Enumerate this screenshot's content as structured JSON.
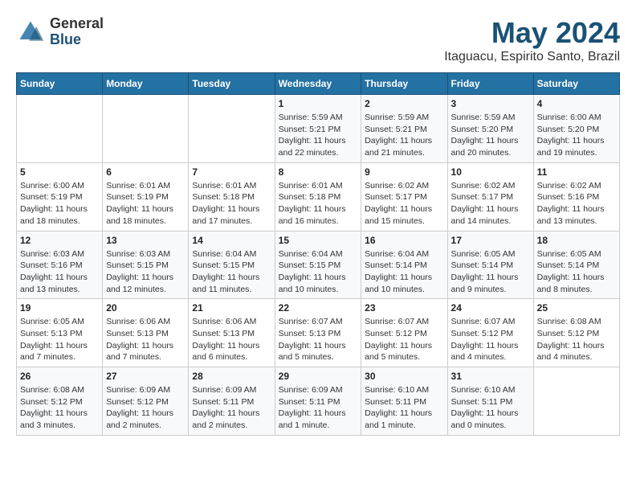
{
  "logo": {
    "general": "General",
    "blue": "Blue"
  },
  "header": {
    "title": "May 2024",
    "subtitle": "Itaguacu, Espirito Santo, Brazil"
  },
  "days_of_week": [
    "Sunday",
    "Monday",
    "Tuesday",
    "Wednesday",
    "Thursday",
    "Friday",
    "Saturday"
  ],
  "weeks": [
    [
      {
        "day": "",
        "info": ""
      },
      {
        "day": "",
        "info": ""
      },
      {
        "day": "",
        "info": ""
      },
      {
        "day": "1",
        "info": "Sunrise: 5:59 AM\nSunset: 5:21 PM\nDaylight: 11 hours and 22 minutes."
      },
      {
        "day": "2",
        "info": "Sunrise: 5:59 AM\nSunset: 5:21 PM\nDaylight: 11 hours and 21 minutes."
      },
      {
        "day": "3",
        "info": "Sunrise: 5:59 AM\nSunset: 5:20 PM\nDaylight: 11 hours and 20 minutes."
      },
      {
        "day": "4",
        "info": "Sunrise: 6:00 AM\nSunset: 5:20 PM\nDaylight: 11 hours and 19 minutes."
      }
    ],
    [
      {
        "day": "5",
        "info": "Sunrise: 6:00 AM\nSunset: 5:19 PM\nDaylight: 11 hours and 18 minutes."
      },
      {
        "day": "6",
        "info": "Sunrise: 6:01 AM\nSunset: 5:19 PM\nDaylight: 11 hours and 18 minutes."
      },
      {
        "day": "7",
        "info": "Sunrise: 6:01 AM\nSunset: 5:18 PM\nDaylight: 11 hours and 17 minutes."
      },
      {
        "day": "8",
        "info": "Sunrise: 6:01 AM\nSunset: 5:18 PM\nDaylight: 11 hours and 16 minutes."
      },
      {
        "day": "9",
        "info": "Sunrise: 6:02 AM\nSunset: 5:17 PM\nDaylight: 11 hours and 15 minutes."
      },
      {
        "day": "10",
        "info": "Sunrise: 6:02 AM\nSunset: 5:17 PM\nDaylight: 11 hours and 14 minutes."
      },
      {
        "day": "11",
        "info": "Sunrise: 6:02 AM\nSunset: 5:16 PM\nDaylight: 11 hours and 13 minutes."
      }
    ],
    [
      {
        "day": "12",
        "info": "Sunrise: 6:03 AM\nSunset: 5:16 PM\nDaylight: 11 hours and 13 minutes."
      },
      {
        "day": "13",
        "info": "Sunrise: 6:03 AM\nSunset: 5:15 PM\nDaylight: 11 hours and 12 minutes."
      },
      {
        "day": "14",
        "info": "Sunrise: 6:04 AM\nSunset: 5:15 PM\nDaylight: 11 hours and 11 minutes."
      },
      {
        "day": "15",
        "info": "Sunrise: 6:04 AM\nSunset: 5:15 PM\nDaylight: 11 hours and 10 minutes."
      },
      {
        "day": "16",
        "info": "Sunrise: 6:04 AM\nSunset: 5:14 PM\nDaylight: 11 hours and 10 minutes."
      },
      {
        "day": "17",
        "info": "Sunrise: 6:05 AM\nSunset: 5:14 PM\nDaylight: 11 hours and 9 minutes."
      },
      {
        "day": "18",
        "info": "Sunrise: 6:05 AM\nSunset: 5:14 PM\nDaylight: 11 hours and 8 minutes."
      }
    ],
    [
      {
        "day": "19",
        "info": "Sunrise: 6:05 AM\nSunset: 5:13 PM\nDaylight: 11 hours and 7 minutes."
      },
      {
        "day": "20",
        "info": "Sunrise: 6:06 AM\nSunset: 5:13 PM\nDaylight: 11 hours and 7 minutes."
      },
      {
        "day": "21",
        "info": "Sunrise: 6:06 AM\nSunset: 5:13 PM\nDaylight: 11 hours and 6 minutes."
      },
      {
        "day": "22",
        "info": "Sunrise: 6:07 AM\nSunset: 5:13 PM\nDaylight: 11 hours and 5 minutes."
      },
      {
        "day": "23",
        "info": "Sunrise: 6:07 AM\nSunset: 5:12 PM\nDaylight: 11 hours and 5 minutes."
      },
      {
        "day": "24",
        "info": "Sunrise: 6:07 AM\nSunset: 5:12 PM\nDaylight: 11 hours and 4 minutes."
      },
      {
        "day": "25",
        "info": "Sunrise: 6:08 AM\nSunset: 5:12 PM\nDaylight: 11 hours and 4 minutes."
      }
    ],
    [
      {
        "day": "26",
        "info": "Sunrise: 6:08 AM\nSunset: 5:12 PM\nDaylight: 11 hours and 3 minutes."
      },
      {
        "day": "27",
        "info": "Sunrise: 6:09 AM\nSunset: 5:12 PM\nDaylight: 11 hours and 2 minutes."
      },
      {
        "day": "28",
        "info": "Sunrise: 6:09 AM\nSunset: 5:11 PM\nDaylight: 11 hours and 2 minutes."
      },
      {
        "day": "29",
        "info": "Sunrise: 6:09 AM\nSunset: 5:11 PM\nDaylight: 11 hours and 1 minute."
      },
      {
        "day": "30",
        "info": "Sunrise: 6:10 AM\nSunset: 5:11 PM\nDaylight: 11 hours and 1 minute."
      },
      {
        "day": "31",
        "info": "Sunrise: 6:10 AM\nSunset: 5:11 PM\nDaylight: 11 hours and 0 minutes."
      },
      {
        "day": "",
        "info": ""
      }
    ]
  ]
}
